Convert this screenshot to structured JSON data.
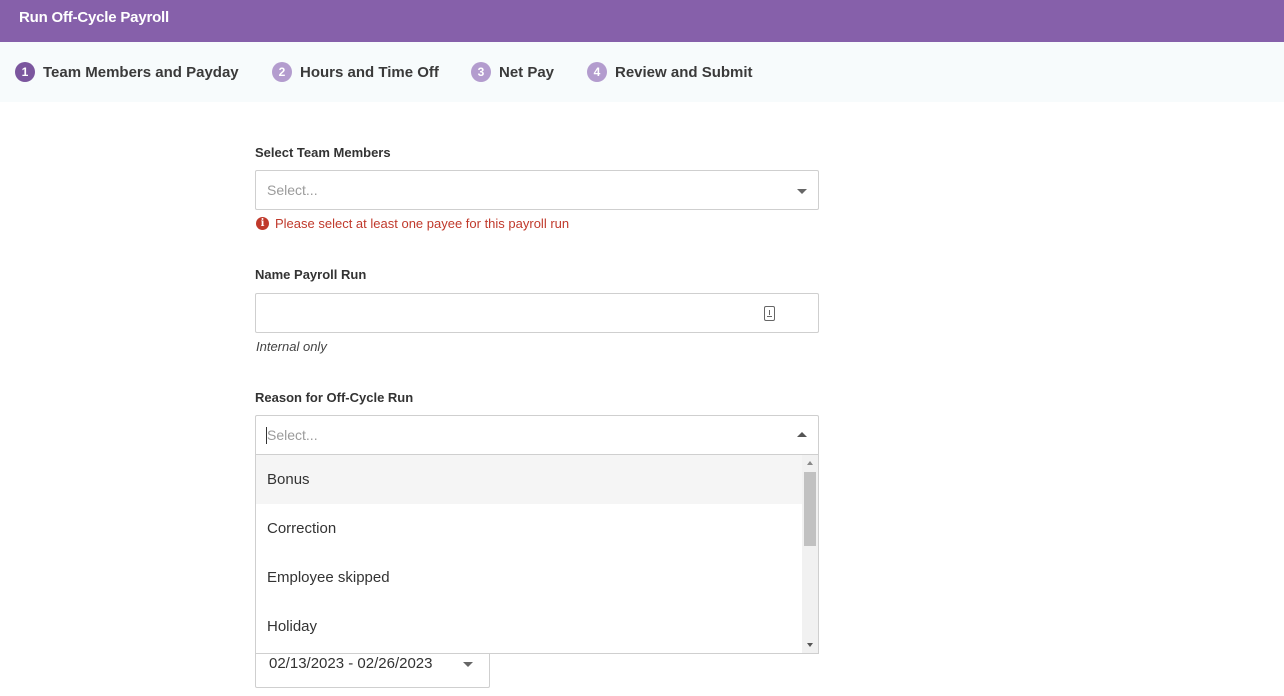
{
  "window": {
    "title": "Run Off-Cycle Payroll"
  },
  "stepper": {
    "steps": [
      {
        "number": "1",
        "label": "Team Members and Payday",
        "state": "active"
      },
      {
        "number": "2",
        "label": "Hours and Time Off",
        "state": "inactive"
      },
      {
        "number": "3",
        "label": "Net Pay",
        "state": "inactive"
      },
      {
        "number": "4",
        "label": "Review and Submit",
        "state": "inactive"
      }
    ]
  },
  "form": {
    "team_members": {
      "label": "Select Team Members",
      "placeholder": "Select...",
      "error": "Please select at least one payee for this payroll run",
      "error_icon": "info-icon"
    },
    "payroll_name": {
      "label": "Name Payroll Run",
      "value": "",
      "hint": "Internal only",
      "icon": "keyboard-icon"
    },
    "reason": {
      "label": "Reason for Off-Cycle Run",
      "placeholder": "Select...",
      "options": [
        "Bonus",
        "Correction",
        "Employee skipped",
        "Holiday"
      ],
      "highlighted": "Bonus"
    },
    "pay_period": {
      "value": "02/13/2023 - 02/26/2023"
    }
  },
  "colors": {
    "header": "#8660aa",
    "step_active": "#7b569e",
    "step_inactive": "#b39cce",
    "error": "#c0392b"
  }
}
